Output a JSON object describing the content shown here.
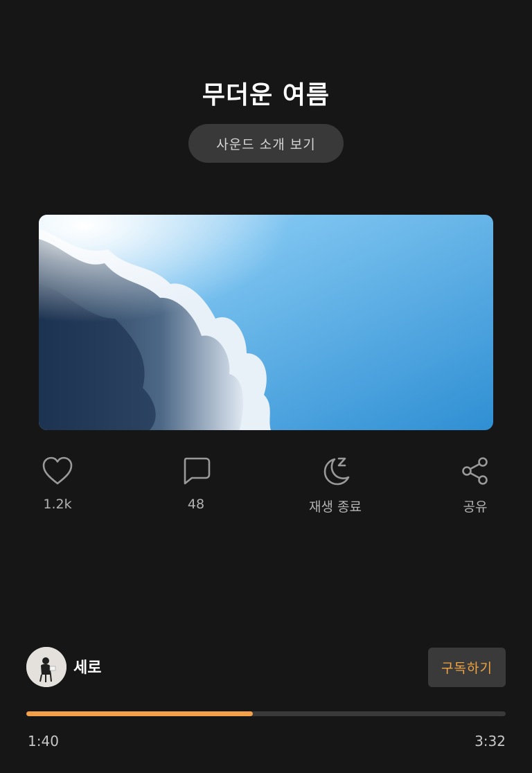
{
  "track": {
    "title": "무더운 여름",
    "intro_button_label": "사운드 소개 보기"
  },
  "cover": {
    "image": "sky-with-clouds-cover",
    "sky_color": "#3f9fdc"
  },
  "actions": [
    {
      "icon": "heart-icon",
      "label": "1.2k"
    },
    {
      "icon": "comment-icon",
      "label": "48"
    },
    {
      "icon": "sleep-timer-icon",
      "label": "재생 종료"
    },
    {
      "icon": "share-icon",
      "label": "공유"
    }
  ],
  "creator": {
    "name": "세로",
    "subscribe_label": "구독하기"
  },
  "player": {
    "current_time": "1:40",
    "total_time": "3:32",
    "progress_percent": 47.2,
    "accent_color": "#f2a04a"
  }
}
